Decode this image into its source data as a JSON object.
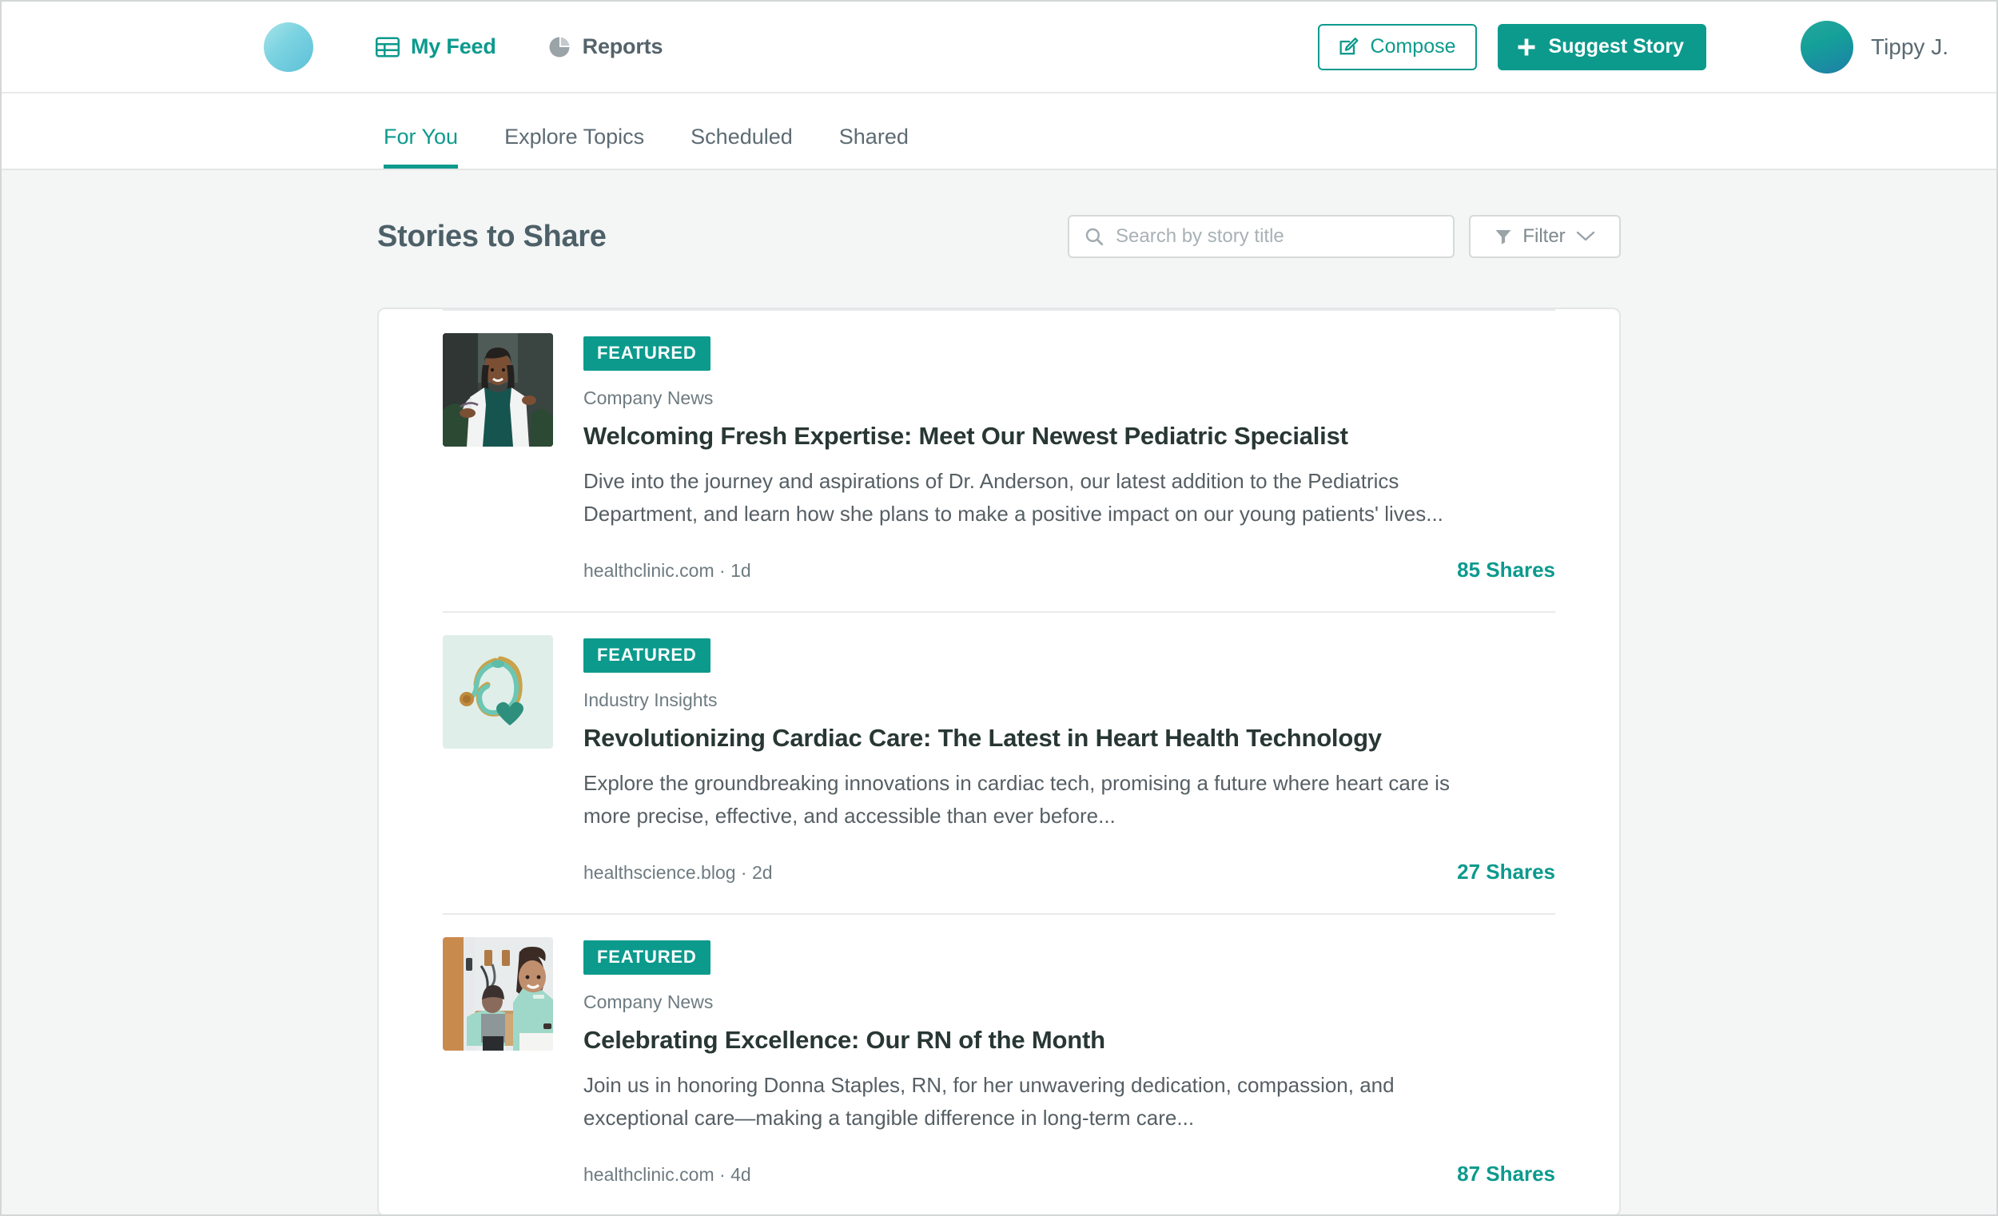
{
  "header": {
    "logo_icon": "circle-logo",
    "nav": [
      {
        "label": "My Feed",
        "icon": "table-icon",
        "active": true
      },
      {
        "label": "Reports",
        "icon": "pie-chart-icon",
        "active": false
      }
    ],
    "compose_label": "Compose",
    "compose_icon": "compose-pencil-icon",
    "suggest_label": "Suggest Story",
    "suggest_icon": "plus-icon",
    "user_name": "Tippy J.",
    "avatar_icon": "user-avatar"
  },
  "tabs": [
    {
      "label": "For You",
      "active": true
    },
    {
      "label": "Explore Topics",
      "active": false
    },
    {
      "label": "Scheduled",
      "active": false
    },
    {
      "label": "Shared",
      "active": false
    }
  ],
  "main": {
    "title": "Stories to Share",
    "search": {
      "placeholder": "Search by story title",
      "value": "",
      "icon": "search-icon"
    },
    "filter": {
      "label": "Filter",
      "icon": "funnel-icon",
      "chevron": "chevron-down-icon"
    },
    "stories": [
      {
        "badge": "FEATURED",
        "category": "Company News",
        "title": "Welcoming Fresh Expertise: Meet Our Newest Pediatric Specialist",
        "description": "Dive into the journey and aspirations of Dr. Anderson, our latest addition to the Pediatrics Department, and learn how she plans to make a positive impact on our young patients' lives...",
        "source": "healthclinic.com · 1d",
        "shares": "85 Shares",
        "thumb_alt": "smiling-doctor-in-white-coat"
      },
      {
        "badge": "FEATURED",
        "category": "Industry Insights",
        "title": "Revolutionizing Cardiac Care: The Latest in Heart Health Technology",
        "description": "Explore the groundbreaking innovations in cardiac tech, promising a future where heart care is more precise, effective, and accessible than ever before...",
        "source": "healthscience.blog · 2d",
        "shares": "27 Shares",
        "thumb_alt": "stethoscope-with-heart-cutout"
      },
      {
        "badge": "FEATURED",
        "category": "Company News",
        "title": "Celebrating Excellence: Our RN of the Month",
        "description": "Join us in honoring Donna Staples, RN, for her unwavering dedication, compassion, and exceptional care—making a tangible difference in long-term care...",
        "source": "healthclinic.com · 4d",
        "shares": "87 Shares",
        "thumb_alt": "nurse-with-patient-in-hospital-room"
      }
    ]
  },
  "colors": {
    "accent": "#0c9a8d",
    "badge_bg": "#0c9a8d",
    "page_bg": "#f4f5f5",
    "text_primary": "#283734",
    "text_muted": "#6e7b81"
  }
}
